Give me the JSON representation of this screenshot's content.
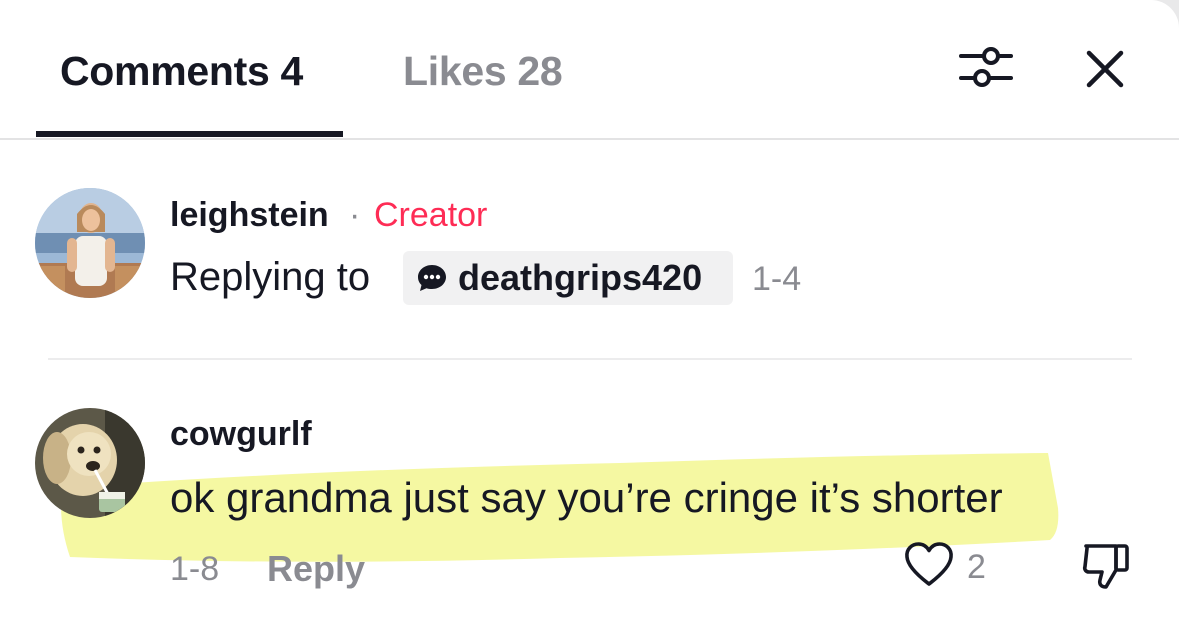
{
  "tabs": {
    "comments_label": "Comments 4",
    "likes_label": "Likes 28"
  },
  "header_icons": {
    "filter": "filter-sliders-icon",
    "close": "close-icon"
  },
  "comments": [
    {
      "username": "leighstein",
      "separator": "·",
      "badge": "Creator",
      "replying_prefix": "Replying to",
      "mention": "deathgrips420",
      "mention_icon": "comment-bubble-icon",
      "date": "1-4"
    },
    {
      "username": "cowgurlf",
      "text": "ok grandma just say you’re cringe it’s shorter",
      "date": "1-8",
      "reply_label": "Reply",
      "like_count": "2",
      "like_icon": "heart-icon",
      "dislike_icon": "thumbs-down-icon"
    }
  ],
  "colors": {
    "primary_text": "#161823",
    "secondary_text": "#8a8b91",
    "creator_accent": "#fe2c55",
    "highlighter": "#f4f79a"
  }
}
